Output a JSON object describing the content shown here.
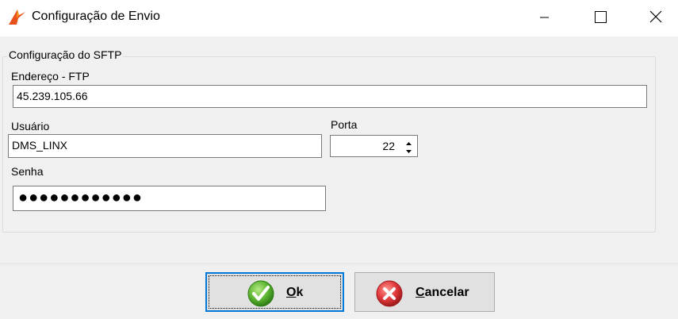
{
  "window": {
    "title": "Configuração de Envio",
    "icon": "app-logo-icon"
  },
  "group": {
    "title": "Configuração do SFTP"
  },
  "fields": {
    "endereco_label": "Endereço - FTP",
    "endereco_value": "45.239.105.66",
    "usuario_label": "Usuário",
    "usuario_value": "DMS_LINX",
    "porta_label": "Porta",
    "porta_value": "22",
    "senha_label": "Senha",
    "senha_mask": "●●●●●●●●●●●●"
  },
  "buttons": {
    "ok_mnemonic": "O",
    "ok_rest": "k",
    "cancel_mnemonic": "C",
    "cancel_rest": "ancelar"
  },
  "colors": {
    "accent": "#0078d7",
    "ok_green": "#5cb531",
    "cancel_red": "#e0383a"
  }
}
